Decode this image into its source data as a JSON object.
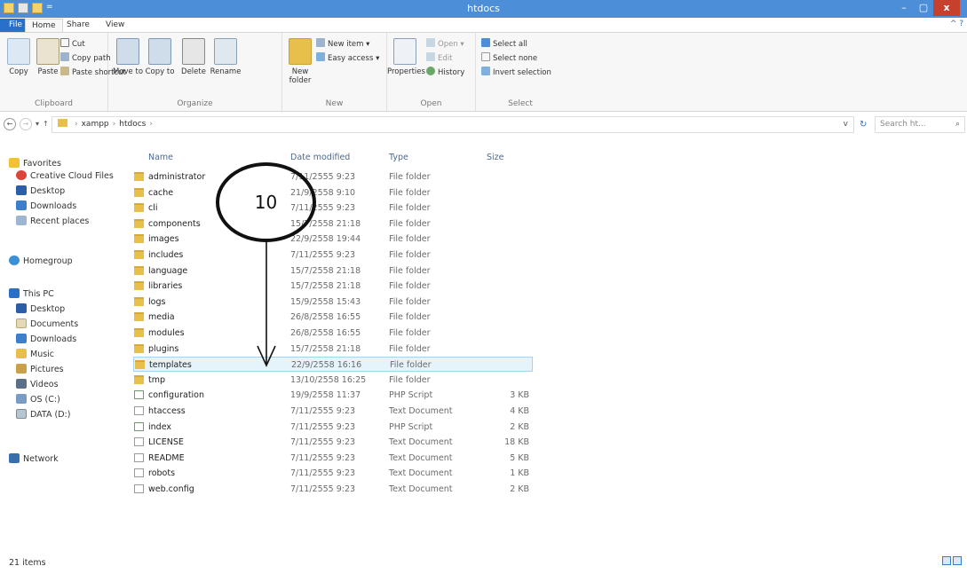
{
  "window": {
    "title": "htdocs",
    "minimize": "–",
    "maximize": "▢",
    "close": "x",
    "qat_arrow": "="
  },
  "tabs": {
    "file": "File",
    "home": "Home",
    "share": "Share",
    "view": "View",
    "help": "^ ?"
  },
  "ribbon": {
    "clipboard": {
      "name": "Clipboard",
      "copy": "Copy",
      "paste": "Paste",
      "cut": "Cut",
      "copy_path": "Copy path",
      "paste_shortcut": "Paste shortcut"
    },
    "organize": {
      "name": "Organize",
      "move_to": "Move to",
      "copy_to": "Copy to",
      "delete": "Delete",
      "rename": "Rename"
    },
    "new": {
      "name": "New",
      "new_folder": "New folder",
      "new_item": "New item ▾",
      "easy_access": "Easy access ▾"
    },
    "open": {
      "name": "Open",
      "properties": "Properties",
      "open": "Open ▾",
      "edit": "Edit",
      "history": "History"
    },
    "select": {
      "name": "Select",
      "select_all": "Select all",
      "select_none": "Select none",
      "invert_selection": "Invert selection"
    }
  },
  "address": {
    "back": "←",
    "forward": "→",
    "recent": "▾",
    "up": "↑",
    "path": [
      "xampp",
      "htdocs"
    ],
    "sep": "›",
    "dropdown": "v",
    "refresh": "↻",
    "search_placeholder": "Search ht...",
    "search_icon": "⌕"
  },
  "navpane": {
    "favorites": "Favorites",
    "creative_cloud": "Creative Cloud Files",
    "desktop": "Desktop",
    "downloads": "Downloads",
    "recent_places": "Recent places",
    "homegroup": "Homegroup",
    "this_pc": "This PC",
    "pc_desktop": "Desktop",
    "documents": "Documents",
    "pc_downloads": "Downloads",
    "music": "Music",
    "pictures": "Pictures",
    "videos": "Videos",
    "os_c": "OS (C:)",
    "data_d": "DATA (D:)",
    "network": "Network"
  },
  "columns": {
    "name": "Name",
    "date": "Date modified",
    "type": "Type",
    "size": "Size"
  },
  "files": [
    {
      "name": "administrator",
      "date": "7/11/2555 9:23",
      "type": "File folder",
      "size": "",
      "kind": "folder"
    },
    {
      "name": "cache",
      "date": "21/9/2558 9:10",
      "type": "File folder",
      "size": "",
      "kind": "folder"
    },
    {
      "name": "cli",
      "date": "7/11/2555 9:23",
      "type": "File folder",
      "size": "",
      "kind": "folder"
    },
    {
      "name": "components",
      "date": "15/7/2558 21:18",
      "type": "File folder",
      "size": "",
      "kind": "folder"
    },
    {
      "name": "images",
      "date": "22/9/2558 19:44",
      "type": "File folder",
      "size": "",
      "kind": "folder"
    },
    {
      "name": "includes",
      "date": "7/11/2555 9:23",
      "type": "File folder",
      "size": "",
      "kind": "folder"
    },
    {
      "name": "language",
      "date": "15/7/2558 21:18",
      "type": "File folder",
      "size": "",
      "kind": "folder"
    },
    {
      "name": "libraries",
      "date": "15/7/2558 21:18",
      "type": "File folder",
      "size": "",
      "kind": "folder"
    },
    {
      "name": "logs",
      "date": "15/9/2558 15:43",
      "type": "File folder",
      "size": "",
      "kind": "folder"
    },
    {
      "name": "media",
      "date": "26/8/2558 16:55",
      "type": "File folder",
      "size": "",
      "kind": "folder"
    },
    {
      "name": "modules",
      "date": "26/8/2558 16:55",
      "type": "File folder",
      "size": "",
      "kind": "folder"
    },
    {
      "name": "plugins",
      "date": "15/7/2558 21:18",
      "type": "File folder",
      "size": "",
      "kind": "folder"
    },
    {
      "name": "templates",
      "date": "22/9/2558 16:16",
      "type": "File folder",
      "size": "",
      "kind": "folder",
      "selected": true
    },
    {
      "name": "tmp",
      "date": "13/10/2558 16:25",
      "type": "File folder",
      "size": "",
      "kind": "folder"
    },
    {
      "name": "configuration",
      "date": "19/9/2558 11:37",
      "type": "PHP Script",
      "size": "3 KB",
      "kind": "php"
    },
    {
      "name": "htaccess",
      "date": "7/11/2555 9:23",
      "type": "Text Document",
      "size": "4 KB",
      "kind": "doc"
    },
    {
      "name": "index",
      "date": "7/11/2555 9:23",
      "type": "PHP Script",
      "size": "2 KB",
      "kind": "php"
    },
    {
      "name": "LICENSE",
      "date": "7/11/2555 9:23",
      "type": "Text Document",
      "size": "18 KB",
      "kind": "doc"
    },
    {
      "name": "README",
      "date": "7/11/2555 9:23",
      "type": "Text Document",
      "size": "5 KB",
      "kind": "doc"
    },
    {
      "name": "robots",
      "date": "7/11/2555 9:23",
      "type": "Text Document",
      "size": "1 KB",
      "kind": "doc"
    },
    {
      "name": "web.config",
      "date": "7/11/2555 9:23",
      "type": "Text Document",
      "size": "2 KB",
      "kind": "doc"
    }
  ],
  "annotation": {
    "number": "10"
  },
  "status": {
    "items": "21 items"
  },
  "colors": {
    "titlebar": "#4d8ed8",
    "file_tab": "#2a6fc9",
    "folder": "#e8bf4a",
    "selection": "#e5f3fb"
  }
}
